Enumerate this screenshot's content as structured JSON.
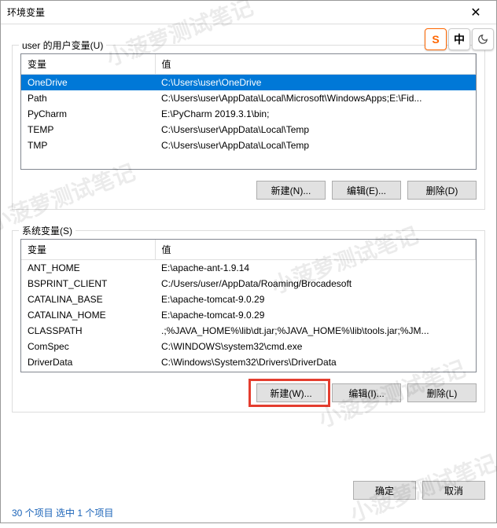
{
  "window": {
    "title": "环境变量"
  },
  "ime": {
    "s": "S",
    "zhong": "中"
  },
  "user_section": {
    "label": "user 的用户变量(U)",
    "headers": {
      "var": "变量",
      "val": "值"
    },
    "rows": [
      {
        "var": "OneDrive",
        "val": "C:\\Users\\user\\OneDrive",
        "selected": true
      },
      {
        "var": "Path",
        "val": "C:\\Users\\user\\AppData\\Local\\Microsoft\\WindowsApps;E:\\Fid..."
      },
      {
        "var": "PyCharm",
        "val": "E:\\PyCharm 2019.3.1\\bin;"
      },
      {
        "var": "TEMP",
        "val": "C:\\Users\\user\\AppData\\Local\\Temp"
      },
      {
        "var": "TMP",
        "val": "C:\\Users\\user\\AppData\\Local\\Temp"
      }
    ],
    "buttons": {
      "new": "新建(N)...",
      "edit": "编辑(E)...",
      "delete": "删除(D)"
    }
  },
  "system_section": {
    "label": "系统变量(S)",
    "headers": {
      "var": "变量",
      "val": "值"
    },
    "rows": [
      {
        "var": "ANT_HOME",
        "val": "E:\\apache-ant-1.9.14"
      },
      {
        "var": "BSPRINT_CLIENT",
        "val": "C:/Users/user/AppData/Roaming/Brocadesoft"
      },
      {
        "var": "CATALINA_BASE",
        "val": "E:\\apache-tomcat-9.0.29"
      },
      {
        "var": "CATALINA_HOME",
        "val": "E:\\apache-tomcat-9.0.29"
      },
      {
        "var": "CLASSPATH",
        "val": ".;%JAVA_HOME%\\lib\\dt.jar;%JAVA_HOME%\\lib\\tools.jar;%JM..."
      },
      {
        "var": "ComSpec",
        "val": "C:\\WINDOWS\\system32\\cmd.exe"
      },
      {
        "var": "DriverData",
        "val": "C:\\Windows\\System32\\Drivers\\DriverData"
      }
    ],
    "buttons": {
      "new": "新建(W)...",
      "edit": "编辑(I)...",
      "delete": "删除(L)"
    }
  },
  "dialog_buttons": {
    "ok": "确定",
    "cancel": "取消"
  },
  "status": "30 个项目    选中 1 个项目",
  "watermark": "小菠萝测试笔记"
}
